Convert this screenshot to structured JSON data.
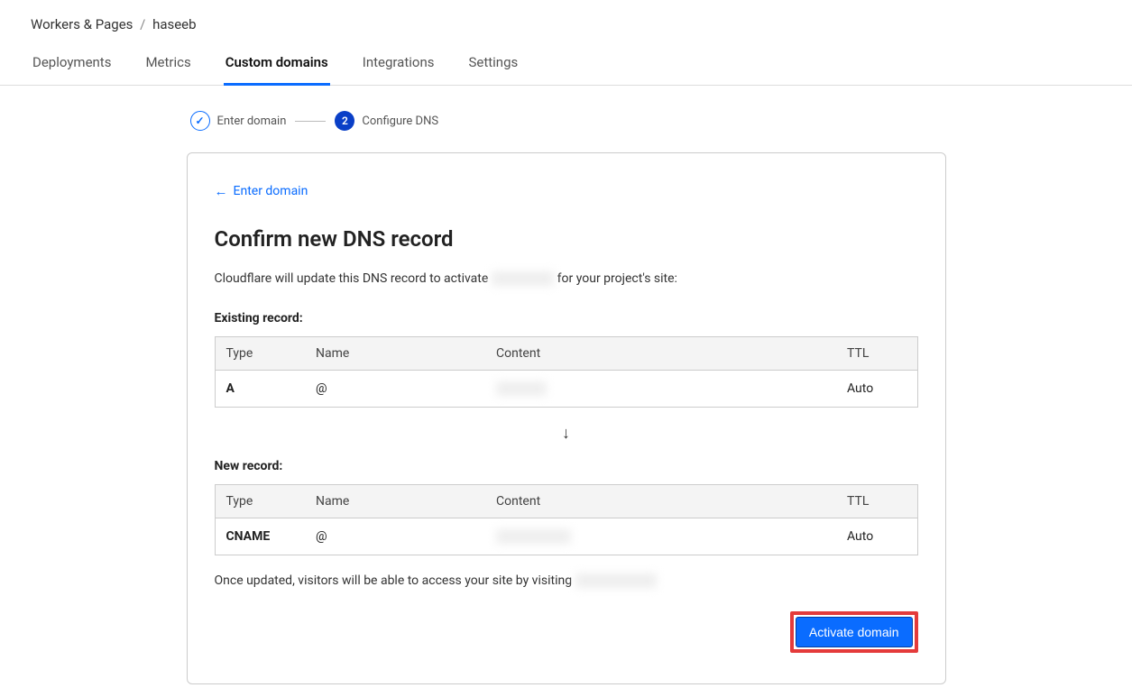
{
  "breadcrumb": {
    "parent": "Workers & Pages",
    "current": "haseeb"
  },
  "tabs": [
    {
      "label": "Deployments",
      "active": false
    },
    {
      "label": "Metrics",
      "active": false
    },
    {
      "label": "Custom domains",
      "active": true
    },
    {
      "label": "Integrations",
      "active": false
    },
    {
      "label": "Settings",
      "active": false
    }
  ],
  "stepper": {
    "step1_label": "Enter domain",
    "step2_number": "2",
    "step2_label": "Configure DNS"
  },
  "back_link": "Enter domain",
  "title": "Confirm new DNS record",
  "lead_prefix": "Cloudflare will update this DNS record to activate ",
  "lead_blur": "                    ",
  "lead_suffix": " for your project's site:",
  "existing_label": "Existing record:",
  "new_label": "New record:",
  "table_headers": {
    "type": "Type",
    "name": "Name",
    "content": "Content",
    "ttl": "TTL"
  },
  "existing": {
    "type": "A",
    "name": "@",
    "content": "                ",
    "ttl": "Auto"
  },
  "new_record": {
    "type": "CNAME",
    "name": "@",
    "content": "                        ",
    "ttl": "Auto"
  },
  "note_prefix": "Once updated, visitors will be able to access your site by visiting ",
  "note_blur": "                          ",
  "activate_label": "Activate domain",
  "icons": {
    "check": "✓",
    "arrow_left": "←",
    "arrow_down": "↓"
  }
}
